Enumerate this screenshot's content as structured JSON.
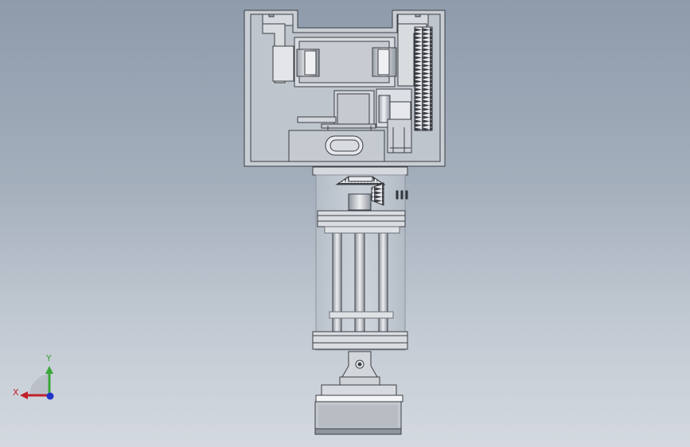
{
  "triad": {
    "x_label": "X",
    "y_label": "Y",
    "x_color": "#c0212b",
    "y_color": "#3aa63a",
    "z_color": "#2233cc"
  },
  "model": {
    "line_color": "#3b3f45",
    "part_fill": "#d6d9de",
    "housing_fill": "#c3c9d0"
  }
}
